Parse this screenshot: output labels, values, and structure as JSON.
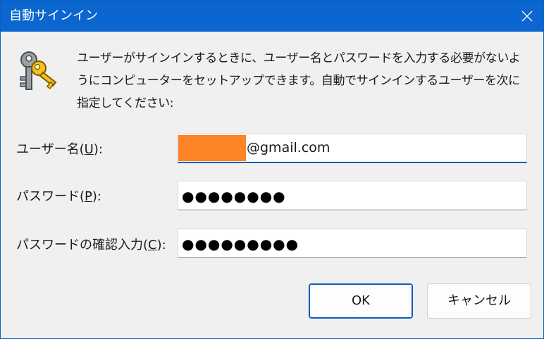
{
  "window": {
    "title": "自動サインイン",
    "close_icon": "close-icon"
  },
  "description": "ユーザーがサインインするときに、ユーザー名とパスワードを入力する必要がないようにコンピューターをセットアップできます。自動でサインインするユーザーを次に指定してください:",
  "fields": {
    "username": {
      "label_prefix": "ユーザー名(",
      "label_key": "U",
      "label_suffix": "):",
      "value": "@gmail.com"
    },
    "password": {
      "label_prefix": "パスワード(",
      "label_key": "P",
      "label_suffix": "):",
      "masked_value": "●●●●●●●●"
    },
    "confirm_password": {
      "label_prefix": "パスワードの確認入力(",
      "label_key": "C",
      "label_suffix": "):",
      "masked_value": "●●●●●●●●●"
    }
  },
  "buttons": {
    "ok_label": "OK",
    "cancel_label": "キャンセル"
  },
  "colors": {
    "titlebar": "#0b66d0",
    "accent": "#0a5cb8",
    "redaction": "#fd8427",
    "background": "#f0f0f0"
  },
  "icons": {
    "header_icon": "keys-icon"
  }
}
